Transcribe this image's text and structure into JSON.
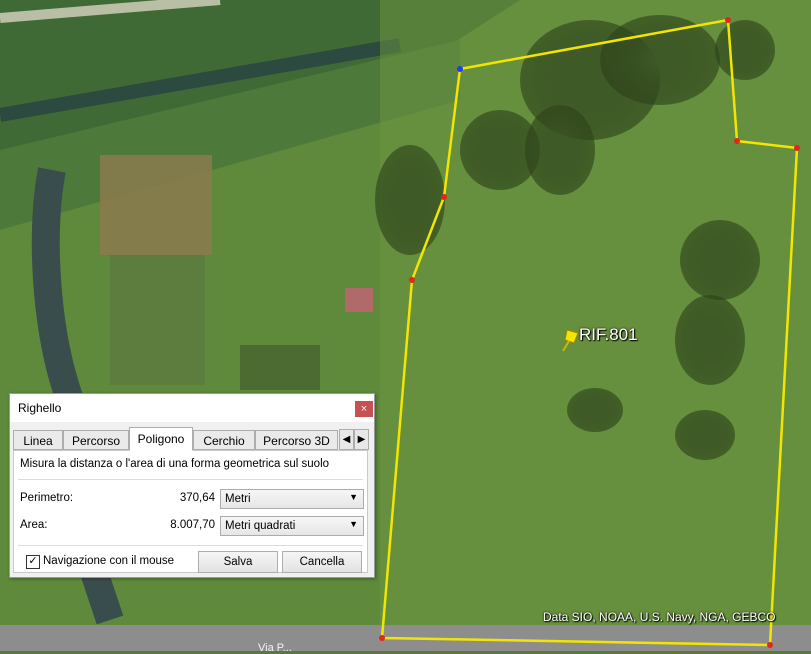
{
  "map": {
    "placemark_label": "RIF.801",
    "attribution": "Data SIO, NOAA, U.S. Navy, NGA, GEBCO",
    "road_label": "Via P..."
  },
  "colors": {
    "polygon": "#f2e600",
    "vertex": "#e2261b",
    "selected_vertex": "#1e3cff"
  },
  "dialog": {
    "title": "Righello",
    "close_glyph": "×",
    "tabs": [
      {
        "label": "Linea",
        "active": false
      },
      {
        "label": "Percorso",
        "active": false
      },
      {
        "label": "Poligono",
        "active": true
      },
      {
        "label": "Cerchio",
        "active": false
      },
      {
        "label": "Percorso 3D",
        "active": false
      }
    ],
    "description": "Misura la distanza o l'area di una forma geometrica sul suolo",
    "perimeter": {
      "label": "Perimetro:",
      "value": "370,64",
      "unit": "Metri"
    },
    "area": {
      "label": "Area:",
      "value": "8.007,70",
      "unit": "Metri quadrati"
    },
    "mouse_nav": {
      "label": "Navigazione con il mouse",
      "checked": true
    },
    "save_label": "Salva",
    "cancel_label": "Cancella"
  }
}
